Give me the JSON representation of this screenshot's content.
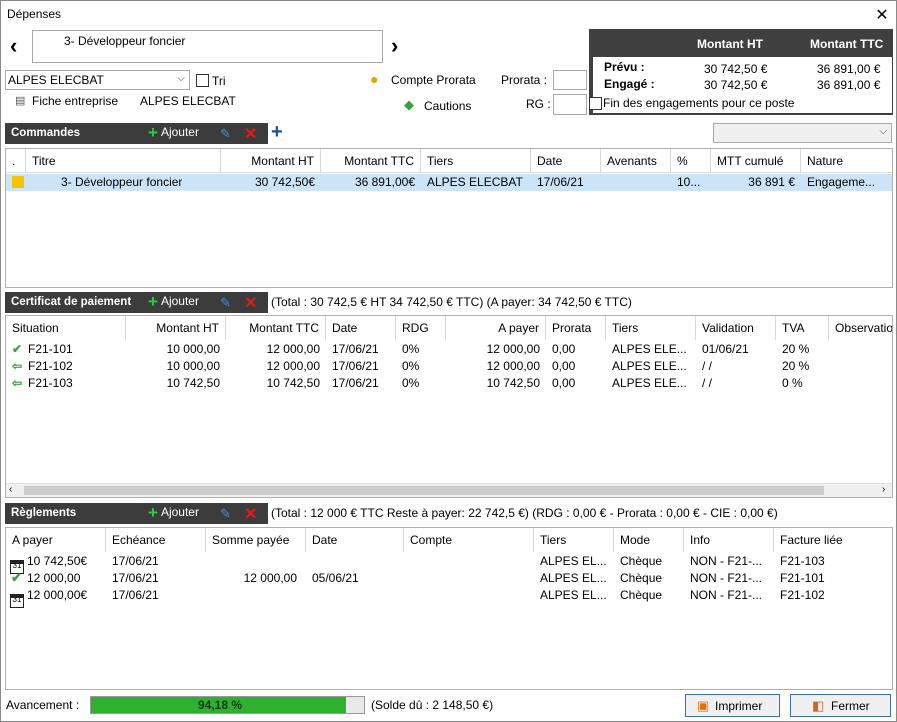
{
  "window": {
    "title": "Dépenses",
    "close": "✕"
  },
  "top": {
    "prev": "‹",
    "next": "›",
    "project_name": "3- Développeur foncier",
    "company_combo": "ALPES ELECBAT",
    "tri_label": "Tri",
    "fiche_label": "Fiche entreprise",
    "fiche_value": "ALPES ELECBAT",
    "compte_prorata": "Compte Prorata",
    "cautions": "Cautions",
    "prorata_label": "Prorata :",
    "rg_label": "RG :",
    "fin_label": "Fin des engagements pour ce poste"
  },
  "summary": {
    "col_ht": "Montant HT",
    "col_ttc": "Montant TTC",
    "prevu_label": "Prévu :",
    "engage_label": "Engagé :",
    "prevu_ht": "30 742,50 €",
    "prevu_ttc": "36 891,00 €",
    "engage_ht": "30 742,50 €",
    "engage_ttc": "36 891,00 €"
  },
  "commandes": {
    "title": "Commandes",
    "add": "Ajouter",
    "headers": {
      "dot": ".",
      "titre": "Titre",
      "mht": "Montant HT",
      "mttc": "Montant TTC",
      "tiers": "Tiers",
      "date": "Date",
      "avenants": "Avenants",
      "pct": "%",
      "mtt": "MTT cumulé",
      "nature": "Nature"
    },
    "row": {
      "titre": "3- Développeur foncier",
      "mht": "30 742,50€",
      "mttc": "36 891,00€",
      "tiers": "ALPES ELECBAT",
      "date": "17/06/21",
      "avenants": "",
      "pct": "10...",
      "mtt": "36 891 €",
      "nature": "Engageme..."
    }
  },
  "certificat": {
    "title": "Certificat de paiement",
    "add": "Ajouter",
    "total": "(Total : 30 742,5 € HT  34 742,50 € TTC) (A payer:  34 742,50 € TTC)",
    "headers": {
      "situation": "Situation",
      "mht": "Montant HT",
      "mttc": "Montant TTC",
      "date": "Date",
      "rdg": "RDG",
      "apayer": "A payer",
      "prorata": "Prorata",
      "tiers": "Tiers",
      "validation": "Validation",
      "tva": "TVA",
      "obs": "Observatio"
    },
    "rows": [
      {
        "icon": "check-icon",
        "situation": "F21-101",
        "mht": "10 000,00",
        "mttc": "12 000,00",
        "date": "17/06/21",
        "rdg": "0%",
        "apayer": "12 000,00",
        "prorata": "0,00",
        "tiers": "ALPES ELE...",
        "validation": "01/06/21",
        "tva": "20 %"
      },
      {
        "icon": "back-arrow-icon",
        "situation": "F21-102",
        "mht": "10 000,00",
        "mttc": "12 000,00",
        "date": "17/06/21",
        "rdg": "0%",
        "apayer": "12 000,00",
        "prorata": "0,00",
        "tiers": "ALPES ELE...",
        "validation": "/  /",
        "tva": "20 %"
      },
      {
        "icon": "back-arrow-icon",
        "situation": "F21-103",
        "mht": "10 742,50",
        "mttc": "10 742,50",
        "date": "17/06/21",
        "rdg": "0%",
        "apayer": "10 742,50",
        "prorata": "0,00",
        "tiers": "ALPES ELE...",
        "validation": "/  /",
        "tva": "0 %"
      }
    ]
  },
  "reglements": {
    "title": "Règlements",
    "add": "Ajouter",
    "total": "(Total : 12 000 € TTC Reste à payer: 22 742,5 €) (RDG : 0,00 € - Prorata : 0,00 € - CIE : 0,00 €)",
    "headers": {
      "apayer": "A payer",
      "echeance": "Echéance",
      "somme": "Somme payée",
      "date": "Date",
      "compte": "Compte",
      "tiers": "Tiers",
      "mode": "Mode",
      "info": "Info",
      "facture": "Facture liée"
    },
    "rows": [
      {
        "icon": "calendar-icon",
        "apayer": "10 742,50€",
        "echeance": "17/06/21",
        "somme": "",
        "date": "",
        "compte": "",
        "tiers": "ALPES EL...",
        "mode": "Chèque",
        "info": "NON - F21-...",
        "facture": "F21-103"
      },
      {
        "icon": "check-icon",
        "apayer": "12 000,00",
        "echeance": "17/06/21",
        "somme": "12 000,00",
        "date": "05/06/21",
        "compte": "",
        "tiers": "ALPES EL...",
        "mode": "Chèque",
        "info": "NON - F21-...",
        "facture": "F21-101"
      },
      {
        "icon": "calendar-icon",
        "apayer": "12 000,00€",
        "echeance": "17/06/21",
        "somme": "",
        "date": "",
        "compte": "",
        "tiers": "ALPES EL...",
        "mode": "Chèque",
        "info": "NON - F21-...",
        "facture": "F21-102"
      }
    ]
  },
  "footer": {
    "avancement_label": "Avancement :",
    "progress_text": "94,18 %",
    "progress_value": 0.9418,
    "solde": "(Solde dû : 2 148,50 €)",
    "imprimer": "Imprimer",
    "fermer": "Fermer"
  },
  "colors": {
    "dark": "#3c3c3c",
    "accent": "#2ecc40",
    "selection": "#cce4f7",
    "progress": "#2fb12f"
  }
}
